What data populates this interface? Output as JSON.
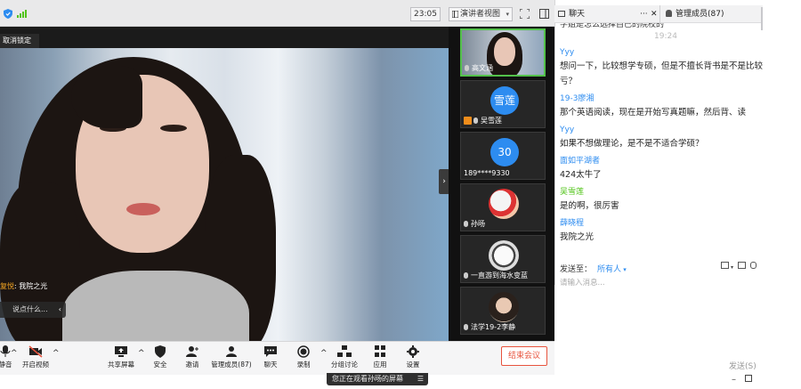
{
  "topbar": {
    "time": "23:05",
    "view_label": "演讲者视图"
  },
  "stage": {
    "unlock_label": "取消锁定",
    "danmu_name": "复悦",
    "danmu_text": "我院之光",
    "say_placeholder": "说点什么...",
    "speaker_name": "文涵"
  },
  "gallery": {
    "tiles": [
      {
        "name": "高文涵",
        "avatar_text": ""
      },
      {
        "name": "吴雪莲",
        "avatar_text": "雪莲"
      },
      {
        "name": "189****9330",
        "avatar_text": "30"
      },
      {
        "name": "孙旸",
        "avatar_text": ""
      },
      {
        "name": "一直游到海水变蓝",
        "avatar_text": ""
      },
      {
        "name": "法学19-2李静",
        "avatar_text": ""
      }
    ]
  },
  "toolbar": {
    "mute_label": "静音",
    "video_label": "开启视频",
    "share_label": "共享屏幕",
    "security_label": "安全",
    "invite_label": "邀请",
    "members_label": "管理成员(87)",
    "chat_label": "聊天",
    "record_label": "录制",
    "breakout_label": "分组讨论",
    "apps_label": "应用",
    "settings_label": "设置",
    "end_label": "结束会议"
  },
  "watch_bar": {
    "text": "您正在观看孙旸的屏幕"
  },
  "chat": {
    "tab_chat": "聊天",
    "tab_members": "管理成员(87)",
    "cut_line": "学姐是怎么选择自己的院校的",
    "timestamp": "19:24",
    "messages": [
      {
        "sender": "Yyy",
        "text": "想问一下，比较想学专硕，但是不擅长背书是不是比较亏？",
        "green": false
      },
      {
        "sender": "19-3廖湘",
        "text": "那个英语阅读，现在是开始写真题嘛，然后背、读",
        "green": false
      },
      {
        "sender": "Yyy",
        "text": "如果不想做理论，是不是不适合学硕？",
        "green": false
      },
      {
        "sender": "面如平湖者",
        "text": "424太牛了",
        "green": false
      },
      {
        "sender": "吴雪莲",
        "text": "是的啊，很厉害",
        "green": true
      },
      {
        "sender": "薛晓程",
        "text": "我院之光",
        "green": false
      }
    ],
    "send_to_label": "发送至：",
    "send_to_value": "所有人",
    "input_placeholder": "请输入消息...",
    "send_label": "发送(S)"
  },
  "colors": {
    "accent_blue": "#2d8cf0",
    "active_green": "#53c14b",
    "end_red": "#e8533d"
  }
}
